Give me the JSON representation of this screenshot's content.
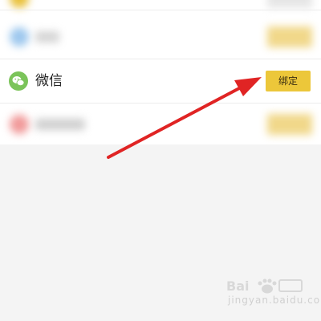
{
  "rows": [
    {
      "label": "",
      "state": "blurred"
    },
    {
      "label": "",
      "state": "blurred"
    },
    {
      "label": "微信",
      "icon": "wechat-icon",
      "button_label": "绑定",
      "state": "visible"
    },
    {
      "label": "",
      "state": "blurred"
    }
  ],
  "colors": {
    "accent_button": "#ecc73a",
    "wechat_green": "#7bc45a",
    "arrow_red": "#e02424",
    "background": "#f4f4f4"
  },
  "annotation": {
    "type": "arrow",
    "color": "red",
    "points_to": "bind-button"
  },
  "watermark": {
    "text": "jingyan.baidu.com"
  }
}
